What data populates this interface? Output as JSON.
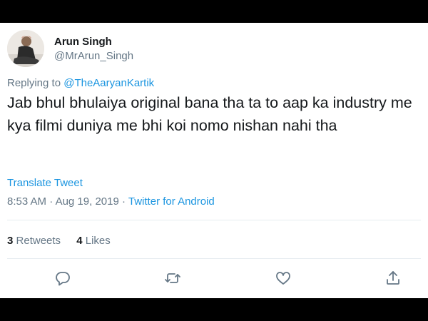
{
  "tweet": {
    "author_name": "Arun Singh",
    "author_handle": "@MrArun_Singh",
    "replying_prefix": "Replying to",
    "replying_to": "@TheAaryanKartik",
    "text": "Jab bhul bhulaiya original bana tha ta to aap ka industry me kya filmi duniya me bhi koi nomo nishan nahi tha",
    "translate_label": "Translate Tweet",
    "time": "8:53 AM",
    "date": "Aug 19, 2019",
    "separator": "·",
    "source": "Twitter for Android",
    "retweets_count": "3",
    "retweets_label": "Retweets",
    "likes_count": "4",
    "likes_label": "Likes"
  },
  "icons": {
    "reply": "reply-icon",
    "retweet": "retweet-icon",
    "like": "heart-icon",
    "share": "share-icon"
  },
  "colors": {
    "link": "#1b95e0",
    "muted": "#657786",
    "text": "#14171a"
  }
}
